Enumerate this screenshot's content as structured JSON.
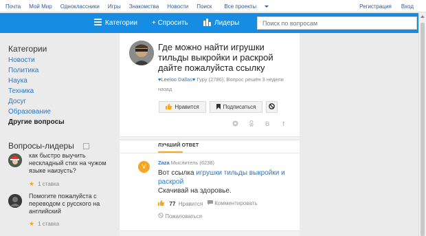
{
  "topnav": {
    "links": [
      "Почта",
      "Мой Мир",
      "Одноклассники",
      "Игры",
      "Знакомства",
      "Новости",
      "Поиск",
      "Все проекты"
    ],
    "register": "Регистрация",
    "login": "Вход"
  },
  "toolbar": {
    "categories": "Категории",
    "ask": "+ Спросить",
    "leaders": "Лидеры",
    "search_placeholder": "Поиск по вопросам"
  },
  "sidebar": {
    "categories_title": "Категории",
    "categories": [
      "Новости",
      "Политика",
      "Наука",
      "Техника",
      "Досуг",
      "Образование",
      "Другие вопросы"
    ],
    "leaders_title": "Вопросы-лидеры",
    "leaders": [
      {
        "line1": "как быстро выучить",
        "line2": "нескладный стих на чужом",
        "line3": "языке наизусть?",
        "stakes": "1 ставка"
      },
      {
        "line1": "Помогите пожалуйста с",
        "line2": "переводом с русского на",
        "line3": "английский",
        "stakes": "1 ставка"
      }
    ]
  },
  "question": {
    "title_lines": [
      "Где можно найти игрушки",
      "тильды выкройки и раскрой",
      "дайте пожалуйста ссылку"
    ],
    "author": "♥Leeloo Dallas♥",
    "meta1": " Гуру (2786), Вопрос решён 3 недели",
    "meta2": "назад",
    "like_label": "Нравится",
    "subscribe_label": "Подписаться"
  },
  "best_answer": {
    "label": "ЛУЧШИЙ ОТВЕТ",
    "avatar_letter": "V",
    "author": "Zaza",
    "author_meta": " Мыслитель (6238)",
    "text_prefix": "Вот ссылка ",
    "link_text": "игрушки тильды выкройки и раскрой",
    "text_line2": "Скачивай на здоровье.",
    "likes_count": "77",
    "likes_label": "Нравится",
    "comment_label": "Комментировать",
    "complain_label": "Пожаловаться"
  },
  "colors": {
    "toolbar_blue": "#168de2",
    "link_blue": "#2a78c8",
    "star_orange": "#f5a623"
  }
}
